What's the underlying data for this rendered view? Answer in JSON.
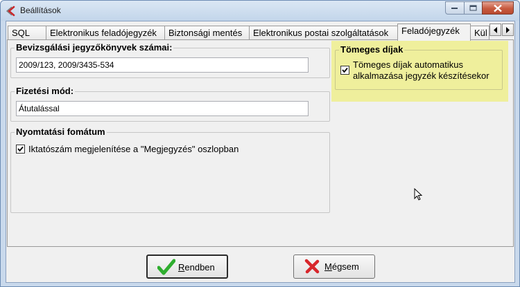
{
  "window": {
    "title": "Beállítások"
  },
  "tabs": [
    {
      "label": "SQL",
      "active": false
    },
    {
      "label": "Elektronikus feladójegyzék",
      "active": false
    },
    {
      "label": "Biztonsági mentés",
      "active": false
    },
    {
      "label": "Elektronikus postai szolgáltatások",
      "active": false
    },
    {
      "label": "Feladójegyzék",
      "active": true
    },
    {
      "label": "Kül",
      "active": false
    }
  ],
  "groups": {
    "protocol": {
      "title": "Bevizsgálási jegyzőkönyvek számai:",
      "value": "2009/123, 2009/3435-534"
    },
    "payment": {
      "title": "Fizetési mód:",
      "value": "Átutalással"
    },
    "print": {
      "title": "Nyomtatási fomátum",
      "checkbox_label": "Iktatószám megjelenítése a \"Megjegyzés\" oszlopban",
      "checked": true
    },
    "bulk": {
      "title": "Tömeges díjak",
      "checkbox_line1": "Tömeges díjak automatikus",
      "checkbox_line2": "alkalmazása jegyzék készítésekor",
      "checked": true
    }
  },
  "buttons": {
    "ok": {
      "accel": "R",
      "rest": "endben"
    },
    "cancel": {
      "accel": "M",
      "rest": "égsem"
    }
  },
  "colors": {
    "highlight": "#efef9c",
    "ok_check": "#2fae2f",
    "cancel_x": "#d8262b"
  }
}
